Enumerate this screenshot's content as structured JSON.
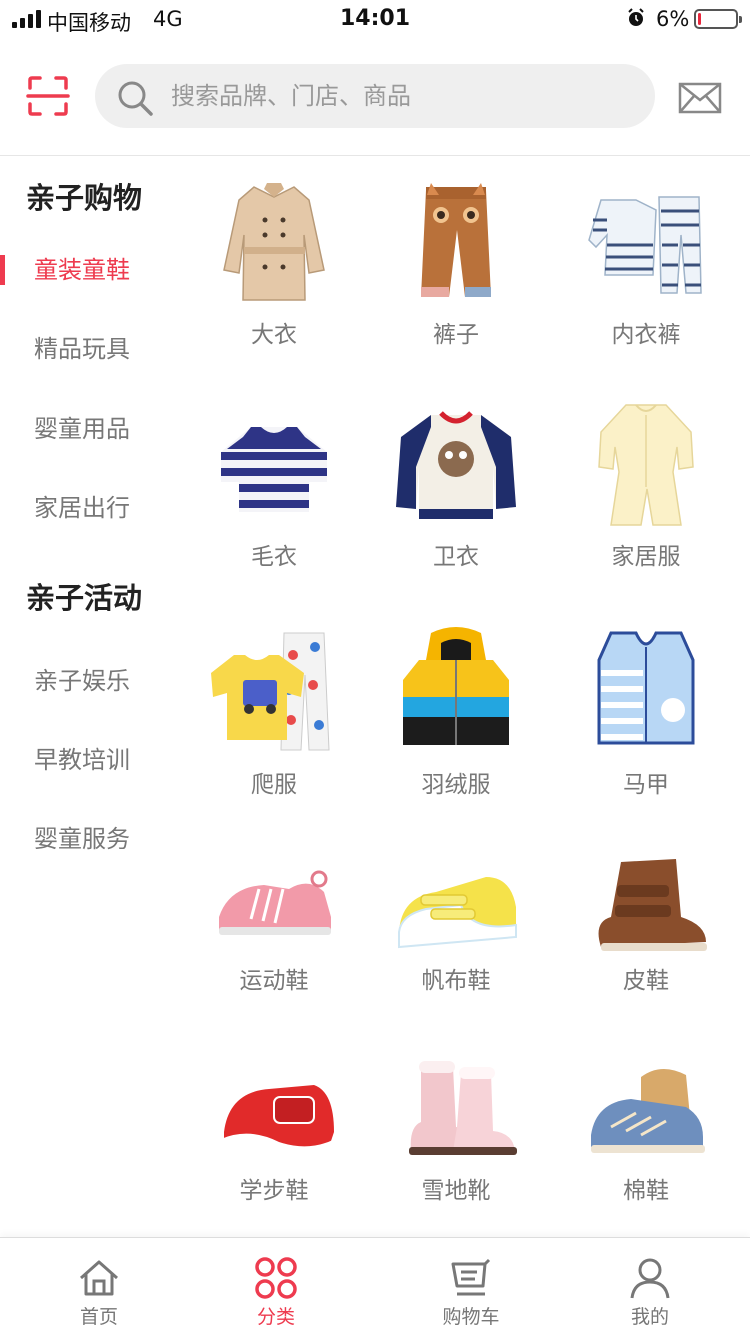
{
  "status_bar": {
    "carrier": "中国移动",
    "network": "4G",
    "time": "14:01",
    "battery": "6%",
    "battery_level": 0.06
  },
  "header": {
    "scan_icon": "scan-icon",
    "search_placeholder": "搜索品牌、门店、商品",
    "mail_icon": "mail-icon"
  },
  "sidebar": {
    "groups": [
      {
        "title": "亲子购物",
        "items": [
          "童装童鞋",
          "精品玩具",
          "婴童用品",
          "家居出行"
        ]
      },
      {
        "title": "亲子活动",
        "items": [
          "亲子娱乐",
          "早教培训",
          "婴童服务"
        ]
      }
    ],
    "active_item": "童装童鞋"
  },
  "grid": {
    "items": [
      {
        "label": "大衣",
        "icon": "trench-coat-icon"
      },
      {
        "label": "裤子",
        "icon": "pants-icon"
      },
      {
        "label": "内衣裤",
        "icon": "underwear-icon"
      },
      {
        "label": "毛衣",
        "icon": "sweater-icon"
      },
      {
        "label": "卫衣",
        "icon": "hoodie-icon"
      },
      {
        "label": "家居服",
        "icon": "homewear-icon"
      },
      {
        "label": "爬服",
        "icon": "romper-icon"
      },
      {
        "label": "羽绒服",
        "icon": "down-jacket-icon"
      },
      {
        "label": "马甲",
        "icon": "vest-icon"
      },
      {
        "label": "运动鞋",
        "icon": "sneaker-icon"
      },
      {
        "label": "帆布鞋",
        "icon": "canvas-shoe-icon"
      },
      {
        "label": "皮鞋",
        "icon": "leather-shoe-icon"
      },
      {
        "label": "学步鞋",
        "icon": "toddler-shoe-icon"
      },
      {
        "label": "雪地靴",
        "icon": "snow-boot-icon"
      },
      {
        "label": "棉鞋",
        "icon": "cotton-shoe-icon"
      }
    ]
  },
  "tabbar": {
    "tabs": [
      {
        "label": "首页",
        "icon": "home-icon"
      },
      {
        "label": "分类",
        "icon": "category-icon"
      },
      {
        "label": "购物车",
        "icon": "cart-icon"
      },
      {
        "label": "我的",
        "icon": "user-icon"
      }
    ],
    "active": "分类"
  },
  "colors": {
    "accent": "#ee3b4f",
    "muted_text": "#777777",
    "search_bg": "#efefef"
  }
}
